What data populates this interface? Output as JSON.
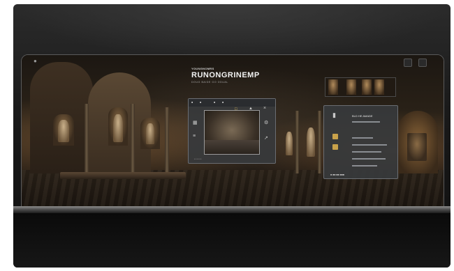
{
  "hero": {
    "kicker": "YOUNGNOMRS",
    "title": "RUNONGRINEMP",
    "subtitle": "DOUG BAIDE GO ODUAL"
  },
  "center_panel": {
    "tabs": [
      "■",
      "■",
      "■",
      "■"
    ],
    "footer": "• • • • • •"
  },
  "right_panel": {
    "title": "BLD HE AMADE"
  },
  "bottom_right_strip": "■ ■■  ■■  ■■■",
  "icons": {
    "camera": "camera-icon",
    "settings": "gear-icon"
  }
}
